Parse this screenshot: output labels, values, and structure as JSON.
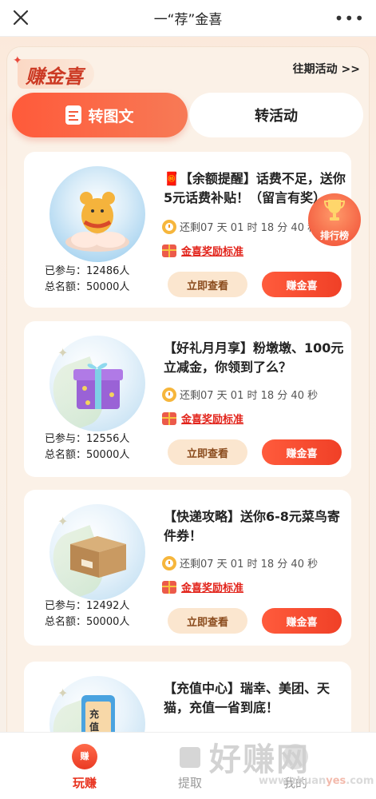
{
  "topbar": {
    "title": "一“荐”金喜",
    "more": "•••"
  },
  "brand": {
    "name": "赚金喜",
    "sparkle": "✦"
  },
  "past_activity": "往期活动 >>",
  "tabs": [
    {
      "label": "转图文",
      "active": true
    },
    {
      "label": "转活动",
      "active": false
    }
  ],
  "ranking": {
    "label": "排行榜"
  },
  "cards": [
    {
      "title": "🧧【余额提醒】话费不足，送你5元话费补贴！（留言有奖）",
      "remaining": "还剩07 天 01 时 18 分 40 秒",
      "reward_link": "金喜奖励标准",
      "joined": "已参与：12486人",
      "total": "总名额：50000人",
      "view_label": "立即查看",
      "earn_label": "赚金喜",
      "thumb_icon": "mouse-on-cloud-icon"
    },
    {
      "title": "【好礼月月享】粉墩墩、100元立减金，你领到了么？",
      "remaining": "还剩07 天 01 时 18 分 40 秒",
      "reward_link": "金喜奖励标准",
      "joined": "已参与：12556人",
      "total": "总名额：50000人",
      "view_label": "立即查看",
      "earn_label": "赚金喜",
      "thumb_icon": "gift-box-icon"
    },
    {
      "title": "【快递攻略】送你6-8元菜鸟寄件券！",
      "remaining": "还剩07 天 01 时 18 分 40 秒",
      "reward_link": "金喜奖励标准",
      "joined": "已参与：12492人",
      "total": "总名额：50000人",
      "view_label": "立即查看",
      "earn_label": "赚金喜",
      "thumb_icon": "parcel-box-icon"
    },
    {
      "title": "【充值中心】瑞幸、美团、天猫，充值一省到底！",
      "thumb_icon": "recharge-phone-icon",
      "thumb_text": "充值"
    }
  ],
  "bottom_nav": [
    {
      "label": "玩赚",
      "icon_text": "赚",
      "active": true
    },
    {
      "label": "提取",
      "active": false
    },
    {
      "label": "我的",
      "active": false
    }
  ],
  "watermark": {
    "big": "好赚网",
    "small_prefix": "www.zhuan",
    "small_yes": "yes",
    "small_suffix": ".com"
  }
}
